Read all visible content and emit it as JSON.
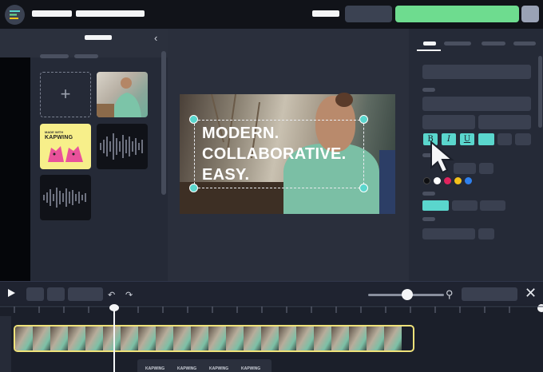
{
  "video_overlay": {
    "lines": [
      "MODERN.",
      "COLLABORATIVE.",
      "EASY."
    ]
  },
  "left_panel": {
    "add_icon": "+",
    "media": [
      {
        "kind": "photo"
      },
      {
        "kind": "logo",
        "small_text": "MADE WITH",
        "brand_text": "KAPWING"
      },
      {
        "kind": "audio"
      },
      {
        "kind": "audio"
      }
    ]
  },
  "format_buttons": [
    "B",
    "I",
    "U"
  ],
  "colors": {
    "accent": "#5ad6cd",
    "primary_button": "#6edc8f",
    "highlight": "#efe27a"
  },
  "swatches": [
    "#0e0f12",
    "#ffffff",
    "#e0245e",
    "#f4c21b",
    "#2f80ed"
  ],
  "icons": {
    "menu": "menu-icon",
    "collapse": "chevron-left-icon",
    "play": "play-icon",
    "undo": "undo-icon",
    "redo": "redo-icon",
    "zoom": "search-icon",
    "close": "close-icon",
    "cursor": "pointer-cursor-icon"
  },
  "timeline": {
    "zoom_level": 0.45
  },
  "bottom_strip": [
    "KAPWING",
    "KAPWING",
    "KAPWING",
    "KAPWING"
  ]
}
